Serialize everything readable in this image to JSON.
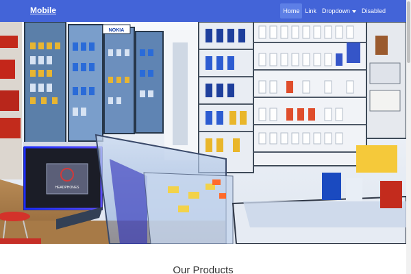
{
  "navbar": {
    "brand": "Mobile",
    "items": [
      {
        "label": "Home",
        "state": "active"
      },
      {
        "label": "Link",
        "state": "normal"
      },
      {
        "label": "Dropdown",
        "state": "dropdown"
      },
      {
        "label": "Disabled",
        "state": "disabled"
      }
    ]
  },
  "hero": {
    "brand_sign": "NOKIA",
    "monitor_text": "HEADPHONES"
  },
  "main": {
    "section_title": "Our Products"
  },
  "colors": {
    "navbar": "#4364d8",
    "active_item": "#5d7fe6"
  }
}
